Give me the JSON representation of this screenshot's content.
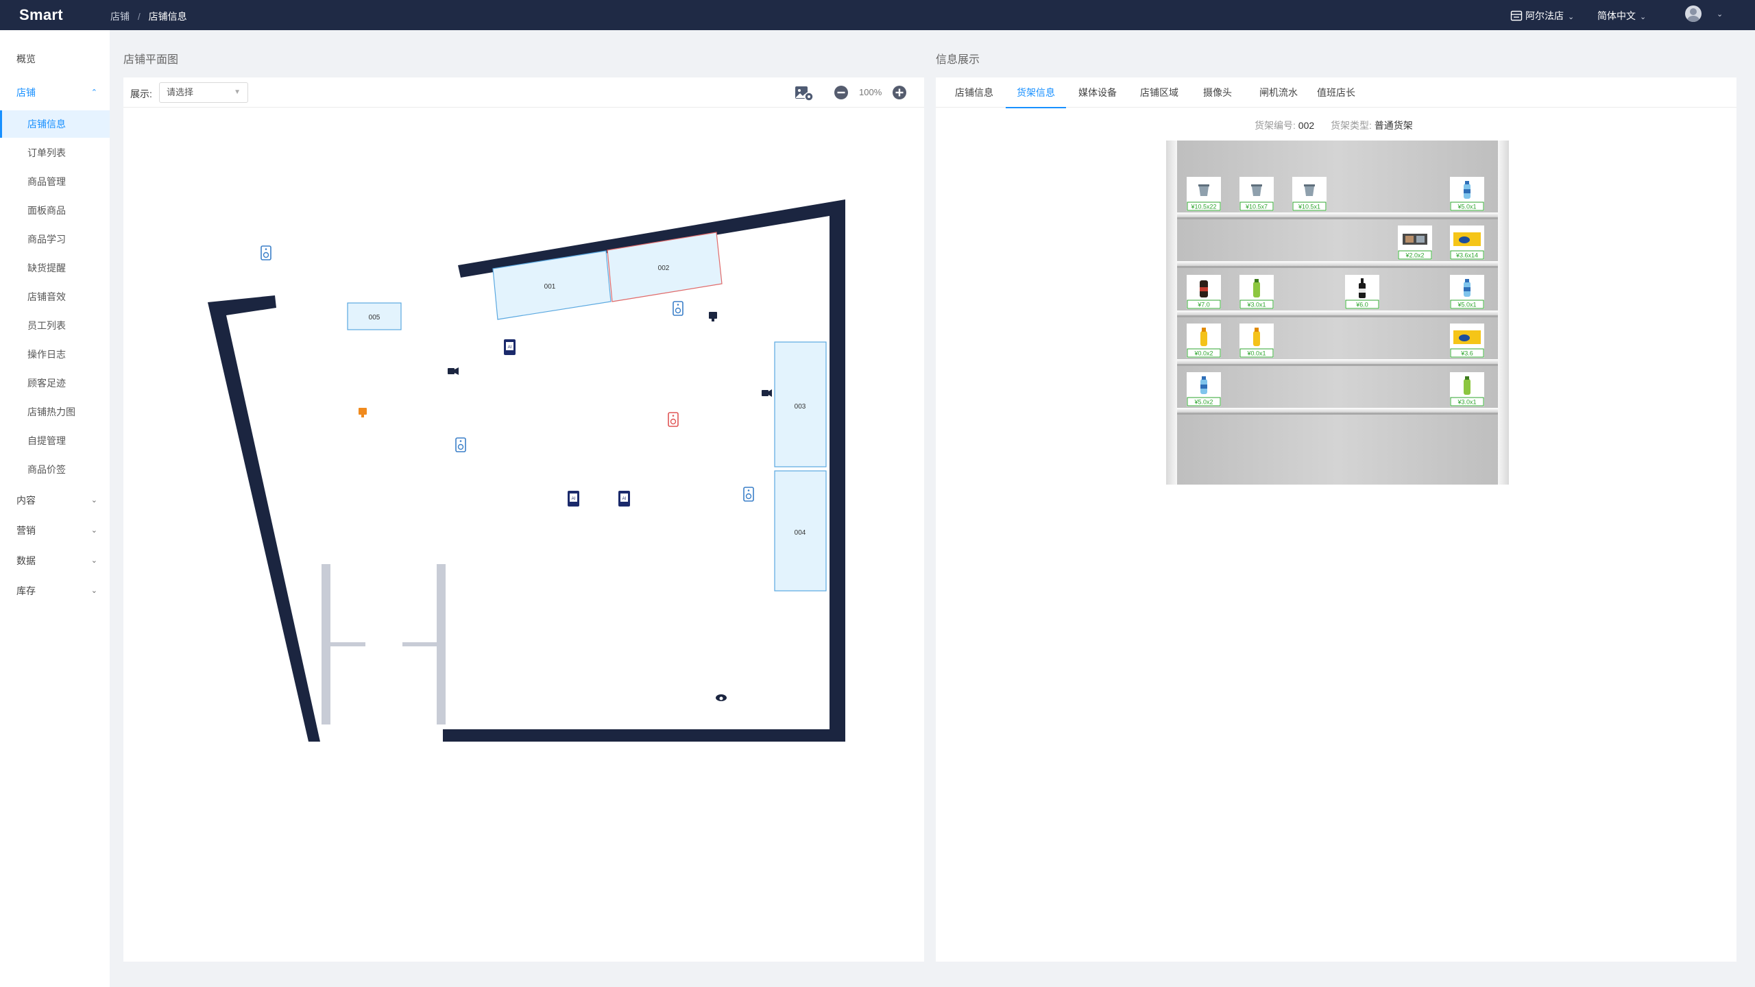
{
  "header": {
    "brand": "Smart",
    "breadcrumb_root": "店铺",
    "breadcrumb_sep": "/",
    "breadcrumb_current": "店铺信息",
    "store_name": "阿尔法店",
    "language": "简体中文",
    "caret": "⌄"
  },
  "sidebar": {
    "overview": "概览",
    "store": "店铺",
    "store_children": [
      "店铺信息",
      "订单列表",
      "商品管理",
      "面板商品",
      "商品学习",
      "缺货提醒",
      "店铺音效",
      "员工列表",
      "操作日志",
      "顾客足迹",
      "店铺热力图",
      "自提管理",
      "商品价签"
    ],
    "content": "内容",
    "marketing": "营销",
    "data": "数据",
    "inventory": "库存"
  },
  "map_panel": {
    "title": "店铺平面图",
    "show_label": "展示:",
    "select_placeholder": "请选择",
    "zoom": "100%",
    "shelves": [
      "001",
      "002",
      "003",
      "004",
      "005"
    ],
    "ai_label": "AI"
  },
  "info_panel": {
    "title": "信息展示",
    "tabs": [
      "店铺信息",
      "货架信息",
      "媒体设备",
      "店铺区域",
      "摄像头",
      "闸机流水",
      "值班店长"
    ],
    "active_tab": "货架信息",
    "shelf_no_label": "货架编号:",
    "shelf_no": "002",
    "shelf_type_label": "货架类型:",
    "shelf_type": "普通货架",
    "shelf_rows": [
      [
        {
          "slot": 0,
          "product": "cup",
          "price": "¥10.5x22"
        },
        {
          "slot": 1,
          "product": "cup",
          "price": "¥10.5x7"
        },
        {
          "slot": 2,
          "product": "cup",
          "price": "¥10.5x1"
        },
        {
          "slot": 5,
          "product": "water",
          "price": "¥5.0x1"
        }
      ],
      [
        {
          "slot": 4,
          "product": "box",
          "price": "¥2.0x2"
        },
        {
          "slot": 5,
          "product": "snack",
          "price": "¥3.6x14"
        }
      ],
      [
        {
          "slot": 0,
          "product": "cola",
          "price": "¥7.0"
        },
        {
          "slot": 1,
          "product": "tea",
          "price": "¥3.0x1"
        },
        {
          "slot": 3,
          "product": "soy",
          "price": "¥6.0"
        },
        {
          "slot": 5,
          "product": "water",
          "price": "¥5.0x1"
        }
      ],
      [
        {
          "slot": 0,
          "product": "juice",
          "price": "¥0.0x2"
        },
        {
          "slot": 1,
          "product": "juice",
          "price": "¥0.0x1"
        },
        {
          "slot": 5,
          "product": "snack",
          "price": "¥3.6"
        }
      ],
      [
        {
          "slot": 0,
          "product": "water",
          "price": "¥5.0x2"
        },
        {
          "slot": 5,
          "product": "tea",
          "price": "¥3.0x1"
        }
      ]
    ]
  },
  "colors": {
    "navy": "#1f2a45",
    "accent": "#1890ff",
    "wall": "#1b2540",
    "shelf_fill": "#e3f3fd",
    "shelf_stroke": "#5aa8e0",
    "selected_stroke": "#e06a6a",
    "price_green": "#2ea52e"
  }
}
